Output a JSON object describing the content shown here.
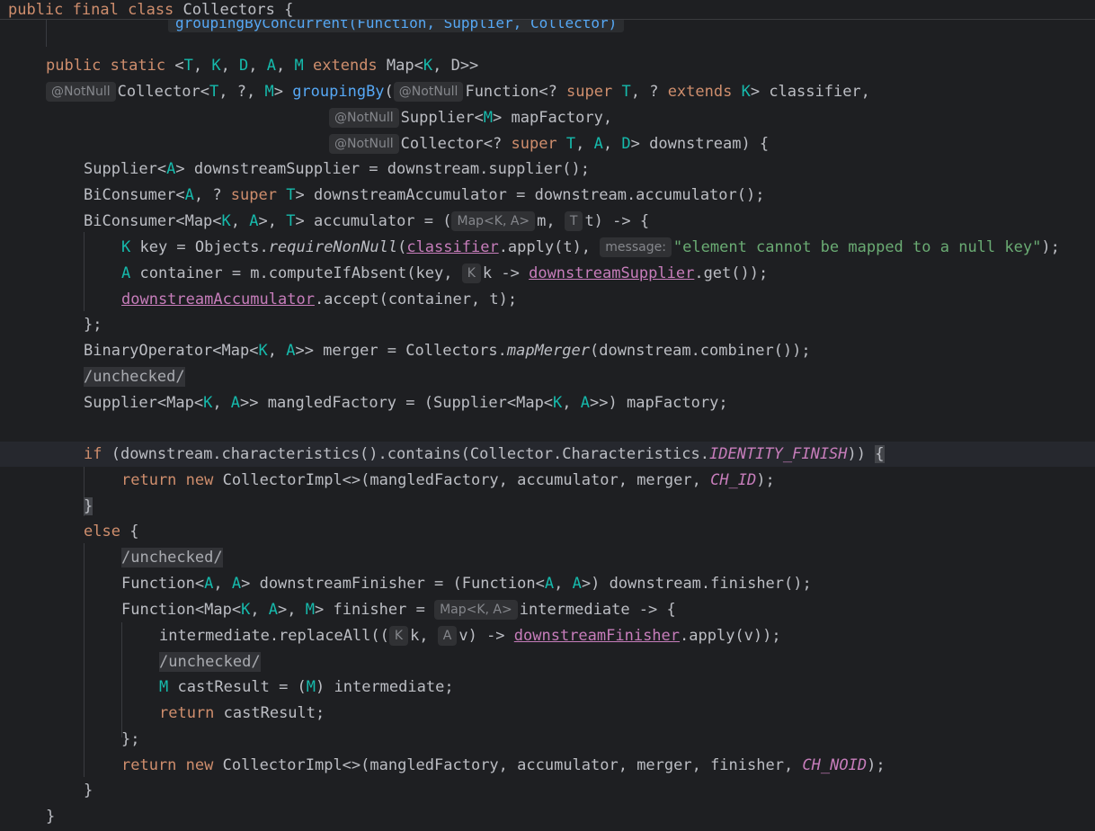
{
  "sticky_header": {
    "kw1": "public",
    "kw2": "final",
    "kw3": "class",
    "class_name": "Collectors",
    "brace": "{"
  },
  "peek_hint": "groupingByConcurrent(Function, Supplier, Collector)",
  "code": {
    "l1": {
      "public": "public",
      "static": "static",
      "open": " <",
      "T": "T",
      ", ": ", ",
      "K": "K",
      "c2": ", ",
      "D": "D",
      "c3": ", ",
      "A": "A",
      "c4": ", ",
      "M": "M",
      "extends": "extends",
      "tail": " Map<",
      "K2": "K",
      ", D": ", D>>"
    },
    "l2": {
      "hint_notnull": "@NotNull",
      "collector": "Collector<",
      "T": "T",
      ", ?,": ", ?, ",
      "M": "M",
      "gt": "> ",
      "name": "groupingBy",
      "paren": "(",
      "hint_notnull2": "@NotNull",
      "function": "Function<? ",
      "super": "super",
      "T2": "T",
      ", ? ": ", ? ",
      "extends": "extends",
      "K": "K",
      "end": "> classifier,"
    },
    "l3": {
      "hint_notnull": "@NotNull",
      "text1": "Supplier<",
      "M": "M",
      "text2": "> mapFactory,"
    },
    "l4": {
      "hint_notnull": "@NotNull",
      "text1": "Collector<? ",
      "super": "super",
      "T": "T",
      ", ": ", ",
      "A": "A",
      ", D": ", ",
      "D": "D",
      "end": "> downstream) {"
    },
    "l5": {
      "text1": "Supplier<",
      "A": "A",
      "text2": "> downstreamSupplier = downstream.supplier();"
    },
    "l6": {
      "text1": "BiConsumer<",
      "A": "A",
      "text2": ", ? ",
      "super": "super",
      "T": "T",
      "text3": "> downstreamAccumulator = downstream.accumulator();"
    },
    "l7": {
      "text1": "BiConsumer<Map<",
      "K": "K",
      ", ": ", ",
      "A": "A",
      "text2": ">, ",
      "T": "T",
      "text3": "> accumulator = (",
      "hint_map": "Map<K, A>",
      "m": "m, ",
      "hint_t": "T",
      "t": "t) -> {"
    },
    "l8": {
      "K": "K",
      "text1": " key = Objects.",
      "require": "requireNonNull",
      "paren": "(",
      "classifier": "classifier",
      "text2": ".apply(t), ",
      "hint_message": "message:",
      "str": "\"element cannot be mapped to a null key\"",
      "end": ");"
    },
    "l9": {
      "A": "A",
      "text1": " container = m.computeIfAbsent(key, ",
      "hint_k": "K",
      "text2": "k -> ",
      "supplier": "downstreamSupplier",
      "end": ".get());"
    },
    "l10": {
      "acc": "downstreamAccumulator",
      "end": ".accept(container, t);"
    },
    "l11": {
      "text": "};"
    },
    "l12": {
      "text1": "BinaryOperator<Map<",
      "K": "K",
      ", ": ", ",
      "A": "A",
      "text2": ">> merger = Collectors.",
      "mapMerger": "mapMerger",
      "end": "(downstream.combiner());"
    },
    "l13": {
      "cmt": "/unchecked/"
    },
    "l14": {
      "text1": "Supplier<Map<",
      "K": "K",
      ", ": ", ",
      "A": "A",
      "text2": ">> mangledFactory = (Supplier<Map<",
      "K2": "K",
      ", 2": ", ",
      "A2": "A",
      "end": ">>) mapFactory;"
    },
    "l16": {
      "if": "if",
      "text1": " (downstream.characteristics().contains(Collector.Characteristics.",
      "const": "IDENTITY_FINISH",
      "text2": ")) ",
      "brace": "{"
    },
    "l17": {
      "return": "return",
      "new": "new",
      "text1": " CollectorImpl<>(mangledFactory, accumulator, merger, ",
      "const": "CH_ID",
      "end": ");"
    },
    "l18": {
      "brace": "}"
    },
    "l19": {
      "else": "else",
      "end": " {"
    },
    "l20": {
      "cmt": "/unchecked/"
    },
    "l21": {
      "text1": "Function<",
      "A": "A",
      ", ": ", ",
      "A2": "A",
      "text2": "> downstreamFinisher = (Function<",
      "A3": "A",
      ", 2": ", ",
      "A4": "A",
      "end": ">) downstream.finisher();"
    },
    "l22": {
      "text1": "Function<Map<",
      "K": "K",
      ", ": ", ",
      "A": "A",
      "text2": ">, ",
      "M": "M",
      "text3": "> finisher = ",
      "hint_map": "Map<K, A>",
      "end": "intermediate -> {"
    },
    "l23": {
      "text1": "intermediate.replaceAll((",
      "hint_k": "K",
      "k": "k, ",
      "hint_a": "A",
      "text2": "v) -> ",
      "finisher": "downstreamFinisher",
      "end": ".apply(v));"
    },
    "l24": {
      "cmt": "/unchecked/"
    },
    "l25": {
      "M": "M",
      "text1": " castResult = (",
      "M2": "M",
      "end": ") intermediate;"
    },
    "l26": {
      "return": "return",
      "end": " castResult;"
    },
    "l27": {
      "text": "};"
    },
    "l28": {
      "return": "return",
      "new": "new",
      "text1": " CollectorImpl<>(mangledFactory, accumulator, merger, finisher, ",
      "const": "CH_NOID",
      "end": ");"
    },
    "l29": {
      "text": "}"
    },
    "l30": {
      "text": "}"
    }
  }
}
